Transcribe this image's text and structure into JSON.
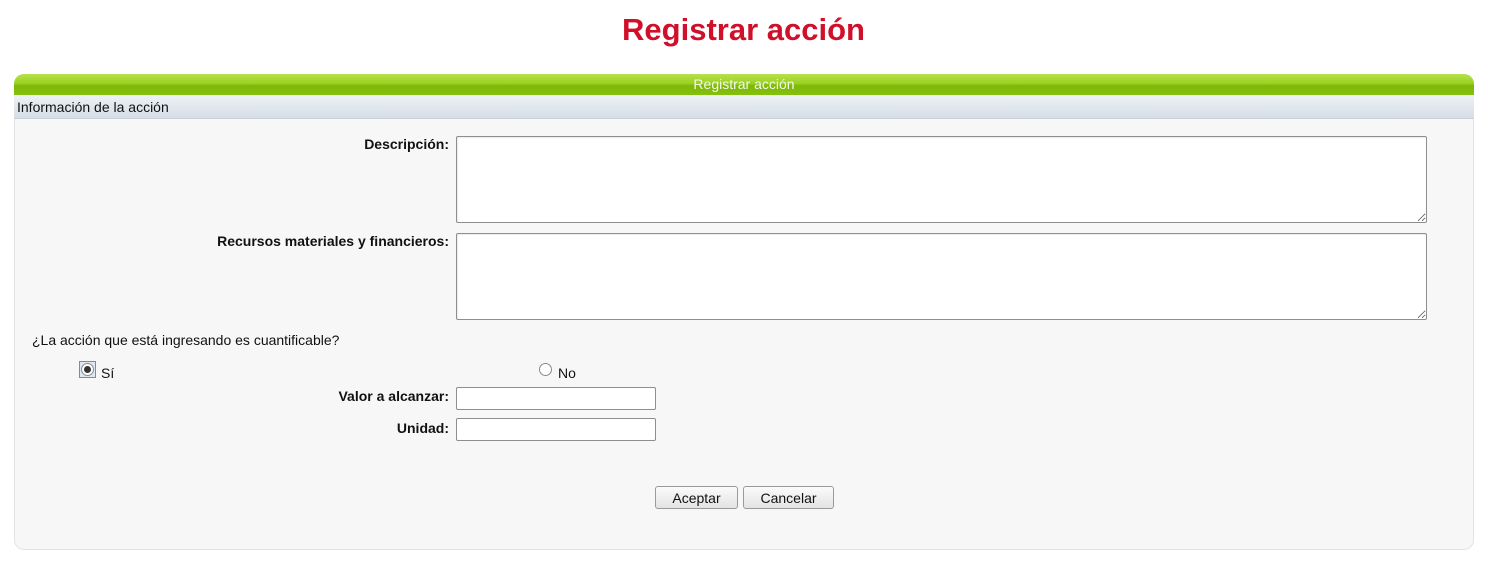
{
  "page": {
    "title": "Registrar acción"
  },
  "panel": {
    "header_title": "Registrar acción",
    "section_title": "Información de la acción"
  },
  "form": {
    "descripcion_label": "Descripción:",
    "descripcion_value": "",
    "recursos_label": "Recursos materiales y financieros:",
    "recursos_value": "",
    "cuantificable_question": "¿La acción que está ingresando es cuantificable?",
    "options": [
      {
        "label": "Sí",
        "selected": true
      },
      {
        "label": "No",
        "selected": false
      }
    ],
    "valor_label": "Valor a alcanzar:",
    "valor_value": "",
    "unidad_label": "Unidad:",
    "unidad_value": ""
  },
  "buttons": {
    "accept": "Aceptar",
    "cancel": "Cancelar"
  },
  "colors": {
    "title": "#d0102a",
    "header_green": "#8cc614",
    "section_bar": "#dbe2ea",
    "panel_bg": "#f7f7f7"
  }
}
